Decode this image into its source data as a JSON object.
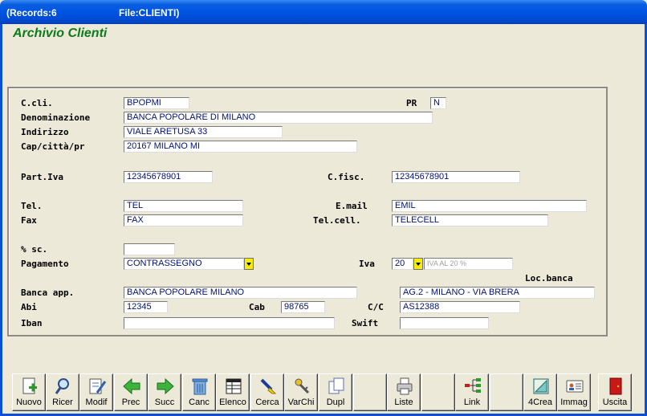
{
  "window": {
    "records_label": "(Records:6",
    "file_label": "File:CLIENTI)"
  },
  "app_title": "Archivio Clienti",
  "form": {
    "ccli": {
      "label": "C.cli.",
      "value": "BPOPMI"
    },
    "pr": {
      "label": "PR",
      "value": "N"
    },
    "denominazione": {
      "label": "Denominazione",
      "value": "BANCA POPOLARE DI MILANO"
    },
    "indirizzo": {
      "label": "Indirizzo",
      "value": "VIALE ARETUSA 33"
    },
    "cap": {
      "label": "Cap/città/pr",
      "value": "20167 MILANO MI"
    },
    "piva": {
      "label": "Part.Iva",
      "value": "12345678901"
    },
    "cfisc": {
      "label": "C.fisc.",
      "value": "12345678901"
    },
    "tel": {
      "label": "Tel.",
      "value": "TEL"
    },
    "email": {
      "label": "E.mail",
      "value": "EMIL"
    },
    "fax": {
      "label": "Fax",
      "value": "FAX"
    },
    "telcell": {
      "label": "Tel.cell.",
      "value": "TELECELL"
    },
    "sconto": {
      "label": "% sc.",
      "value": ""
    },
    "pagamento": {
      "label": "Pagamento",
      "value": "CONTRASSEGNO"
    },
    "iva": {
      "label": "Iva",
      "value": "20",
      "description": "IVA AL 20 %"
    },
    "locbanca": {
      "label": "Loc.banca",
      "value": "AG.2 - MILANO - VIA BRERA"
    },
    "banca": {
      "label": "Banca app.",
      "value": "BANCA POPOLARE MILANO"
    },
    "abi": {
      "label": "Abi",
      "value": "12345"
    },
    "cab": {
      "label": "Cab",
      "value": "98765"
    },
    "cc": {
      "label": "C/C",
      "value": "AS12388"
    },
    "iban": {
      "label": "Iban",
      "value": ""
    },
    "swift": {
      "label": "Swift",
      "value": ""
    }
  },
  "toolbar": {
    "nuovo": "Nuovo",
    "ricer": "Ricer",
    "modif": "Modif",
    "prec": "Prec",
    "succ": "Succ",
    "canc": "Canc",
    "elenco": "Elenco",
    "cerca": "Cerca",
    "varchi": "VarChi",
    "dupl": "Dupl",
    "liste": "Liste",
    "link": "Link",
    "crea4": "4Crea",
    "immag": "Immag",
    "uscita": "Uscita"
  },
  "colors": {
    "title_bar": "#0054e3",
    "app_title": "#0c7b1b",
    "field_text": "#00117a",
    "dropdown_button": "#f6f000"
  }
}
